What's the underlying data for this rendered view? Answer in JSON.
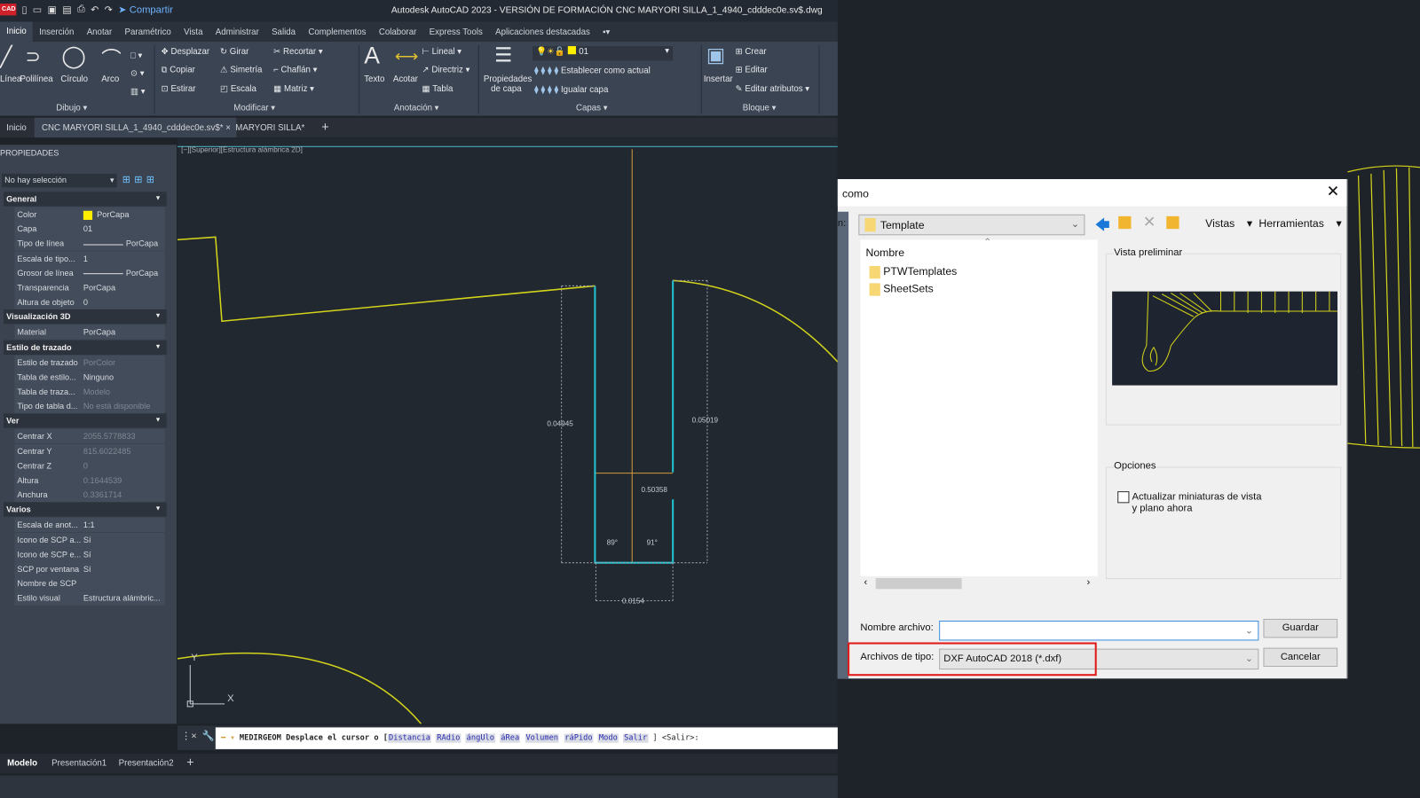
{
  "titlebar": {
    "logo": "CAD",
    "share": "Compartir",
    "title": "Autodesk AutoCAD 2023 - VERSIÓN DE FORMACIÓN   CNC MARYORI SILLA_1_4940_cdddec0e.sv$.dwg"
  },
  "ribbon_tabs": [
    "Inicio",
    "Inserción",
    "Anotar",
    "Paramétrico",
    "Vista",
    "Administrar",
    "Salida",
    "Complementos",
    "Colaborar",
    "Express Tools",
    "Aplicaciones destacadas"
  ],
  "ribbon": {
    "dibujo": {
      "items": [
        "Línea",
        "Polilínea",
        "Círculo",
        "Arco"
      ],
      "label": "Dibujo ▾"
    },
    "modificar": {
      "items": [
        "Desplazar",
        "Girar",
        "Recortar",
        "Copiar",
        "Simetría",
        "Chaflán",
        "Estirar",
        "Escala",
        "Matriz"
      ],
      "label": "Modificar ▾"
    },
    "anotacion": {
      "texto": "Texto",
      "acotar": "Acotar",
      "lineal": "Lineal",
      "directriz": "Directriz",
      "tabla": "Tabla",
      "label": "Anotación ▾"
    },
    "capas": {
      "propiedades": "Propiedades de capa",
      "layer_value": "01",
      "establecer": "Establecer como actual",
      "igualar": "Igualar capa",
      "label": "Capas ▾"
    },
    "bloque": {
      "insertar": "Insertar",
      "crear": "Crear",
      "editar": "Editar",
      "editar_atributos": "Editar atributos",
      "label": "Bloque ▾"
    }
  },
  "doc_tabs": {
    "home": "Inicio",
    "active": "CNC MARYORI SILLA_1_4940_cdddec0e.sv$*",
    "other": "MARYORI SILLA*",
    "add": "+"
  },
  "properties": {
    "title": "PROPIEDADES",
    "selection": "No hay selección",
    "sections": [
      {
        "name": "General",
        "rows": [
          [
            "Color",
            "PorCapa"
          ],
          [
            "Capa",
            "01"
          ],
          [
            "Tipo de línea",
            "PorCapa"
          ],
          [
            "Escala de tipo...",
            "1"
          ],
          [
            "Grosor de línea",
            "PorCapa"
          ],
          [
            "Transparencia",
            "PorCapa"
          ],
          [
            "Altura de objeto",
            "0"
          ]
        ]
      },
      {
        "name": "Visualización 3D",
        "rows": [
          [
            "Material",
            "PorCapa"
          ]
        ]
      },
      {
        "name": "Estilo de trazado",
        "rows": [
          [
            "Estilo de trazado",
            "PorColor"
          ],
          [
            "Tabla de estilo...",
            "Ninguno"
          ],
          [
            "Tabla de traza...",
            "Modelo"
          ],
          [
            "Tipo de tabla d...",
            "No está disponible"
          ]
        ]
      },
      {
        "name": "Ver",
        "rows": [
          [
            "Centrar X",
            "2055.5778833"
          ],
          [
            "Centrar Y",
            "815.6022485"
          ],
          [
            "Centrar Z",
            "0"
          ],
          [
            "Altura",
            "0.1644539"
          ],
          [
            "Anchura",
            "0.3361714"
          ]
        ]
      },
      {
        "name": "Varios",
        "rows": [
          [
            "Escala de anot...",
            "1:1"
          ],
          [
            "Icono de SCP a...",
            "Sí"
          ],
          [
            "Icono de SCP e...",
            "Sí"
          ],
          [
            "SCP por ventana",
            "Sí"
          ],
          [
            "Nombre de SCP",
            ""
          ],
          [
            "Estilo visual",
            "Estructura alámbric..."
          ]
        ]
      }
    ]
  },
  "viewport": {
    "label": "[−][Superior][Estructura alámbrica 2D]",
    "dims": [
      "0.04945",
      "0.05019",
      "0.50358",
      "89°",
      "91°",
      "0.0154"
    ],
    "ucs_x": "X",
    "ucs_y": "Y"
  },
  "command": {
    "prefix": "MEDIRGEOM Desplace el cursor o [",
    "options": [
      "Distancia",
      "RAdio",
      "ángUlo",
      "áRea",
      "Volumen",
      "ráPido",
      "Modo",
      "Salir"
    ],
    "suffix": "] <Salir>:"
  },
  "layout_tabs": [
    "Modelo",
    "Presentación1",
    "Presentación2",
    "+"
  ],
  "dialog": {
    "title": "como",
    "lookin_label": "n:",
    "folder": "Template",
    "vistas": "Vistas",
    "herramientas": "Herramientas",
    "column": "Nombre",
    "files": [
      "PTWTemplates",
      "SheetSets"
    ],
    "preview": "Vista preliminar",
    "options": "Opciones",
    "checkbox": "Actualizar miniaturas de vista y plano ahora",
    "checkbox_checked": false,
    "filename_label": "Nombre archivo:",
    "filename_value": "",
    "filetype_label": "Archivos de tipo:",
    "filetype_value": "DXF AutoCAD 2018 (*.dxf)",
    "save": "Guardar",
    "cancel": "Cancelar"
  },
  "colors": {
    "highlight": "#e01818",
    "geometry": "#d4d41a",
    "cyan": "#22c3d0",
    "orange": "#d49a3a"
  }
}
